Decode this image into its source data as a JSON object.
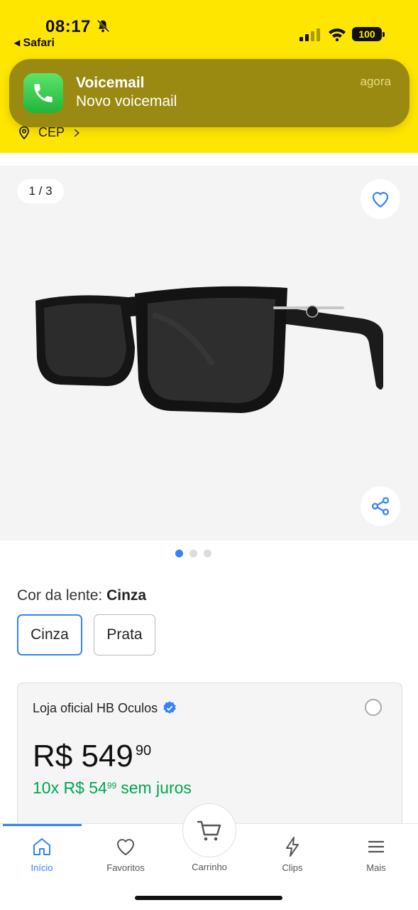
{
  "status_bar": {
    "time": "08:17",
    "back_app": "◂ Safari",
    "battery": "100"
  },
  "notification": {
    "title": "Voicemail",
    "body": "Novo voicemail",
    "time": "agora"
  },
  "location": {
    "label": "CEP"
  },
  "gallery": {
    "counter": "1 / 3",
    "page_dots": 3,
    "active_dot": 0
  },
  "lens": {
    "label_prefix": "Cor da lente: ",
    "selected": "Cinza",
    "options": [
      "Cinza",
      "Prata"
    ]
  },
  "seller": {
    "name": "Loja oficial HB Oculos",
    "price_main": "R$ 549",
    "price_cents": "90",
    "installments_prefix": "10x R$ 54",
    "installments_cents": "99",
    "installments_suffix": "sem juros"
  },
  "bottom_nav": {
    "home": "Início",
    "favorites": "Favoritos",
    "cart": "Carrinho",
    "clips": "Clips",
    "more": "Mais"
  },
  "colors": {
    "brand_yellow": "#ffe600",
    "accent_blue": "#3483fa",
    "green": "#00a650"
  }
}
